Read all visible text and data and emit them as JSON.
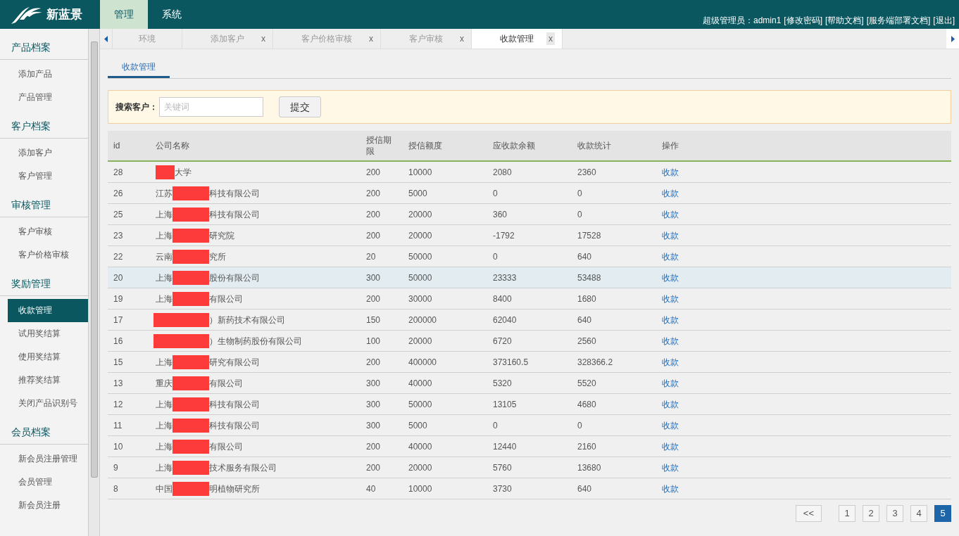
{
  "app": {
    "name": "新蓝景"
  },
  "top_nav": [
    {
      "label": "管理",
      "selected": true
    },
    {
      "label": "系统",
      "selected": false
    }
  ],
  "user_bar": {
    "user": "超级管理员：admin1",
    "links": [
      "[修改密码]",
      "[帮助文档]",
      "[服务端部署文档]",
      "[退出]"
    ]
  },
  "sidebar": {
    "groups": [
      {
        "title": "产品档案",
        "items": [
          {
            "label": "添加产品",
            "selected": false
          },
          {
            "label": "产品管理",
            "selected": false
          }
        ]
      },
      {
        "title": "客户档案",
        "items": [
          {
            "label": "添加客户",
            "selected": false
          },
          {
            "label": "客户管理",
            "selected": false
          }
        ]
      },
      {
        "title": "审核管理",
        "items": [
          {
            "label": "客户审核",
            "selected": false
          },
          {
            "label": "客户价格审核",
            "selected": false
          }
        ]
      },
      {
        "title": "奖励管理",
        "items": [
          {
            "label": "收款管理",
            "selected": true
          },
          {
            "label": "试用奖结算",
            "selected": false
          },
          {
            "label": "使用奖结算",
            "selected": false
          },
          {
            "label": "推荐奖结算",
            "selected": false
          },
          {
            "label": "关闭产品识别号",
            "selected": false
          }
        ]
      },
      {
        "title": "会员档案",
        "items": [
          {
            "label": "新会员注册管理",
            "selected": false
          },
          {
            "label": "会员管理",
            "selected": false
          },
          {
            "label": "新会员注册",
            "selected": false
          }
        ]
      }
    ]
  },
  "tabs": [
    {
      "label": "环境",
      "selected": false
    },
    {
      "label": "添加客户",
      "close": "x",
      "selected": false
    },
    {
      "label": "客户价格审核",
      "close": "x",
      "selected": false
    },
    {
      "label": "客户审核",
      "close": "x",
      "selected": false
    },
    {
      "label": "收款管理",
      "close": "x",
      "selected": true
    }
  ],
  "page_tab": "收款管理",
  "search": {
    "label": "搜索客户：",
    "placeholder": "关键词",
    "button": "提交"
  },
  "table": {
    "columns": [
      "id",
      "公司名称",
      "授信期限",
      "授信额度",
      "应收款余额",
      "收款统计",
      "操作"
    ],
    "rows": [
      {
        "id": "28",
        "kind": "lead",
        "name_start": "",
        "name_end": "大学",
        "term": "200",
        "limit": "10000",
        "balance": "2080",
        "total": "2360",
        "action": "收款",
        "highlighted": false
      },
      {
        "id": "26",
        "kind": "mid",
        "name_start": "江苏",
        "name_end": "科技有限公司",
        "term": "200",
        "limit": "5000",
        "balance": "0",
        "total": "0",
        "action": "收款",
        "highlighted": false
      },
      {
        "id": "25",
        "kind": "mid",
        "name_start": "上海",
        "name_end": "科技有限公司",
        "term": "200",
        "limit": "20000",
        "balance": "360",
        "total": "0",
        "action": "收款",
        "highlighted": false
      },
      {
        "id": "23",
        "kind": "mid",
        "name_start": "上海",
        "name_end": "研究院",
        "term": "200",
        "limit": "20000",
        "balance": "-1792",
        "total": "17528",
        "action": "收款",
        "highlighted": false
      },
      {
        "id": "22",
        "kind": "mid",
        "name_start": "云南",
        "name_end": "究所",
        "term": "20",
        "limit": "50000",
        "balance": "0",
        "total": "640",
        "action": "收款",
        "highlighted": false
      },
      {
        "id": "20",
        "kind": "mid",
        "name_start": "上海",
        "name_end": "股份有限公司",
        "term": "300",
        "limit": "50000",
        "balance": "23333",
        "total": "53488",
        "action": "收款",
        "highlighted": true
      },
      {
        "id": "19",
        "kind": "mid",
        "name_start": "上海",
        "name_end": "有限公司",
        "term": "200",
        "limit": "30000",
        "balance": "8400",
        "total": "1680",
        "action": "收款",
        "highlighted": false
      },
      {
        "id": "17",
        "kind": "wide",
        "name_start": "",
        "name_end": "）新药技术有限公司",
        "term": "150",
        "limit": "200000",
        "balance": "62040",
        "total": "640",
        "action": "收款",
        "highlighted": false
      },
      {
        "id": "16",
        "kind": "wide",
        "name_start": "",
        "name_end": "）生物制药股份有限公司",
        "term": "100",
        "limit": "20000",
        "balance": "6720",
        "total": "2560",
        "action": "收款",
        "highlighted": false
      },
      {
        "id": "15",
        "kind": "mid",
        "name_start": "上海",
        "name_end": "研究有限公司",
        "term": "200",
        "limit": "400000",
        "balance": "373160.5",
        "total": "328366.2",
        "action": "收款",
        "highlighted": false
      },
      {
        "id": "13",
        "kind": "mid",
        "name_start": "重庆",
        "name_end": "有限公司",
        "term": "300",
        "limit": "40000",
        "balance": "5320",
        "total": "5520",
        "action": "收款",
        "highlighted": false
      },
      {
        "id": "12",
        "kind": "mid",
        "name_start": "上海",
        "name_end": "科技有限公司",
        "term": "300",
        "limit": "50000",
        "balance": "13105",
        "total": "4680",
        "action": "收款",
        "highlighted": false
      },
      {
        "id": "11",
        "kind": "mid",
        "name_start": "上海",
        "name_end": "科技有限公司",
        "term": "300",
        "limit": "5000",
        "balance": "0",
        "total": "0",
        "action": "收款",
        "highlighted": false
      },
      {
        "id": "10",
        "kind": "mid",
        "name_start": "上海",
        "name_end": "有限公司",
        "term": "200",
        "limit": "40000",
        "balance": "12440",
        "total": "2160",
        "action": "收款",
        "highlighted": false
      },
      {
        "id": "9",
        "kind": "mid",
        "name_start": "上海",
        "name_end": "技术服务有限公司",
        "term": "200",
        "limit": "20000",
        "balance": "5760",
        "total": "13680",
        "action": "收款",
        "highlighted": false
      },
      {
        "id": "8",
        "kind": "mid",
        "name_start": "中国",
        "name_end": "明植物研究所",
        "term": "40",
        "limit": "10000",
        "balance": "3730",
        "total": "640",
        "action": "收款",
        "highlighted": false
      }
    ]
  },
  "pagination": [
    {
      "label": "<<",
      "selected": false
    },
    {
      "label": "1",
      "selected": false
    },
    {
      "label": "2",
      "selected": false
    },
    {
      "label": "3",
      "selected": false
    },
    {
      "label": "4",
      "selected": false
    },
    {
      "label": "5",
      "selected": true
    }
  ]
}
